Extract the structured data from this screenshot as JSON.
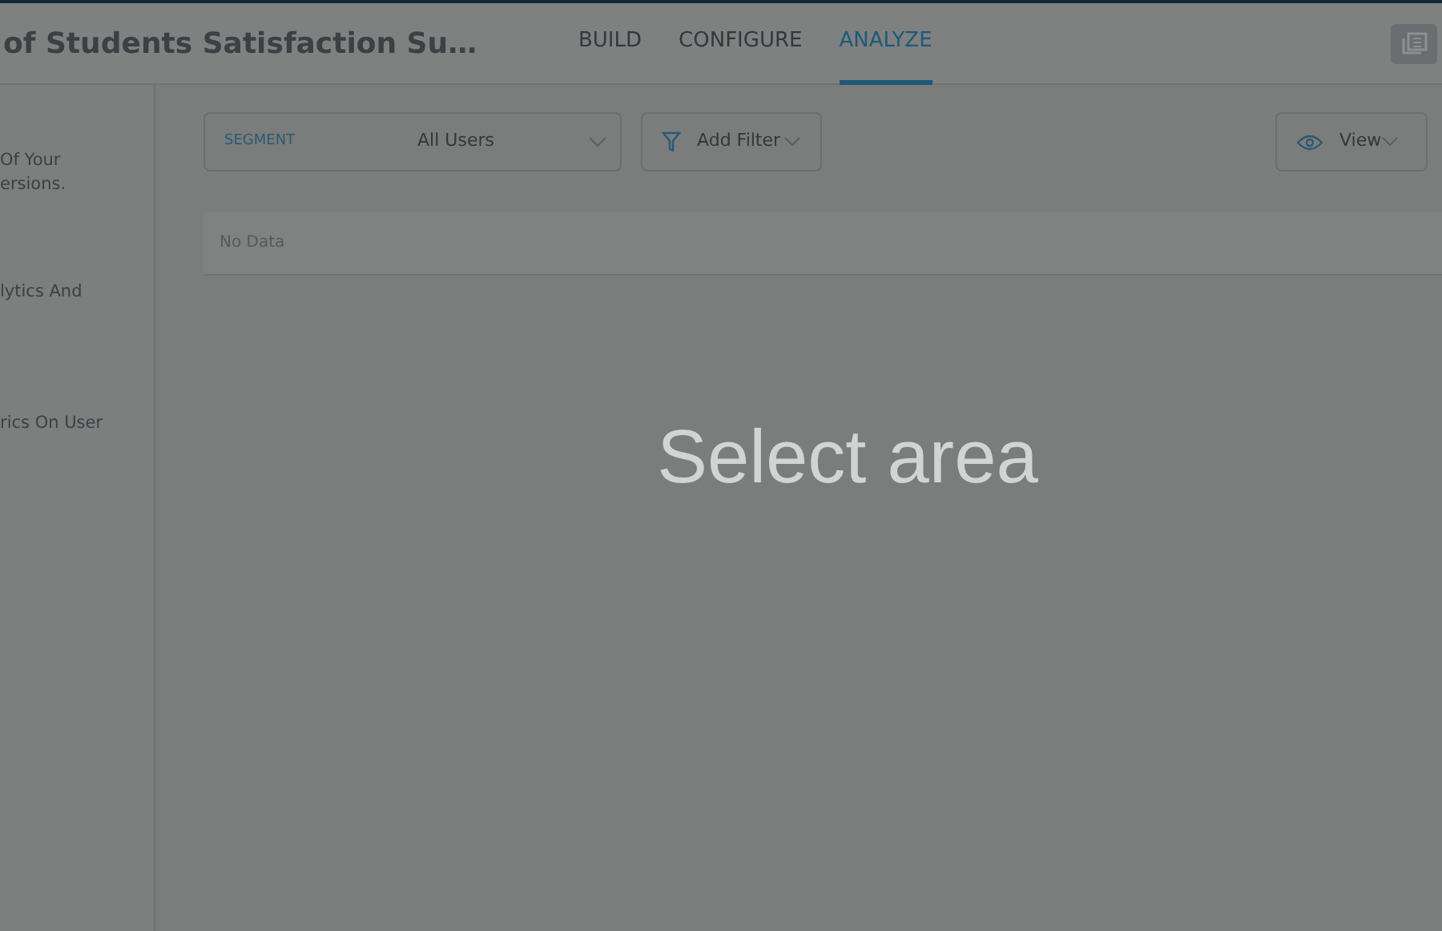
{
  "header": {
    "title": "of Students Satisfaction Su…",
    "tabs": [
      {
        "label": "BUILD",
        "selected": false
      },
      {
        "label": "CONFIGURE",
        "selected": false
      },
      {
        "label": "ANALYZE",
        "selected": true
      }
    ]
  },
  "sidebar": {
    "items": [
      "Of Your\nersions.",
      "lytics And",
      "rics On User"
    ]
  },
  "toolbar": {
    "segment_label": "SEGMENT",
    "segment_value": "All Users",
    "filter_button": "Add Filter",
    "view_button": "View"
  },
  "results": {
    "empty_text": "No Data"
  },
  "overlay": {
    "text": "Select area"
  }
}
